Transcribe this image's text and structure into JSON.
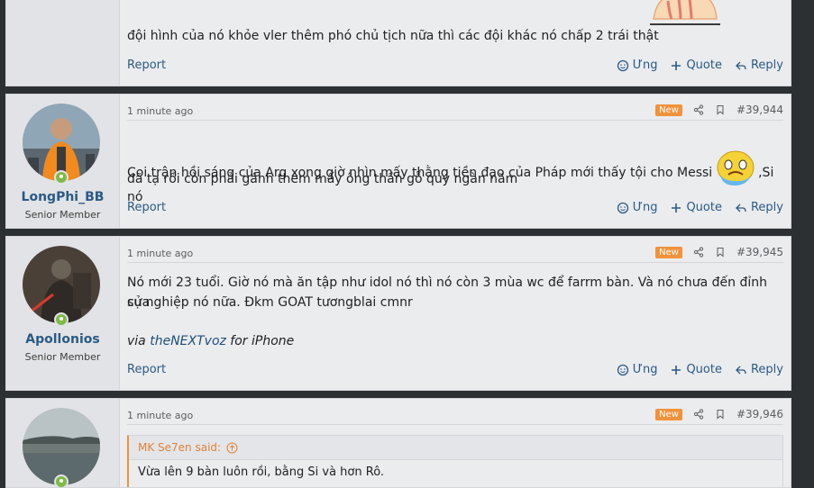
{
  "posts": [
    {
      "message": "đội hình của nó khỏe vler thêm phó chủ tịch nữa thì các đội khác nó chấp 2 trái thật",
      "actions": {
        "report": "Report",
        "react": "Ưng",
        "quote": "Quote",
        "reply": "Reply"
      }
    },
    {
      "username": "LongPhi_BB",
      "user_title": "Senior Member",
      "time": "1 minute ago",
      "badge": "New",
      "post_number": "#39,944",
      "message_line1": "Coi trận hồi sáng của Arg xong giờ nhìn mấy thằng tiền đạo của Pháp mới thấy tội cho Messi",
      "message_line1_end": ",Si nó",
      "message_line2": "đã tạ rồi còn phải gánh thêm mấy ông thần gỗ quý ngàn năm",
      "actions": {
        "report": "Report",
        "react": "Ưng",
        "quote": "Quote",
        "reply": "Reply"
      }
    },
    {
      "username": "Apollonios",
      "user_title": "Senior Member",
      "time": "1 minute ago",
      "badge": "New",
      "post_number": "#39,945",
      "message_line1": "Nó mới 23 tuổi. Giờ nó mà ăn tập như idol nó thì nó còn 3 mùa wc để farrm bàn. Và nó chưa đến đỉnh của",
      "message_line2": "sự nghiệp nó nữa. Đkm GOAT tươngblai cmnr",
      "via_prefix": "via ",
      "via_link": "theNEXTvoz",
      "via_suffix": " for iPhone",
      "actions": {
        "report": "Report",
        "react": "Ưng",
        "quote": "Quote",
        "reply": "Reply"
      }
    },
    {
      "time": "1 minute ago",
      "badge": "New",
      "post_number": "#39,946",
      "quote_author": "MK Se7en said:",
      "quote_text": "Vừa lên 9 bàn luôn rồi, bằng Si và hơn Rô."
    }
  ],
  "colors": {
    "badge": "#f2923a",
    "link": "#2a5a86",
    "online": "#7fba4a"
  }
}
